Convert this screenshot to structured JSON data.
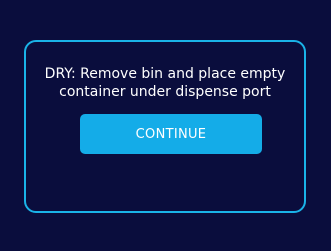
{
  "dialog": {
    "message_line1": "DRY: Remove bin and place empty",
    "message_line2": "container under dispense port",
    "continue_label": "CONTINUE"
  },
  "colors": {
    "background": "#0a0d3d",
    "accent": "#14ace8",
    "border": "#1ab3e8",
    "text": "#ffffff"
  }
}
